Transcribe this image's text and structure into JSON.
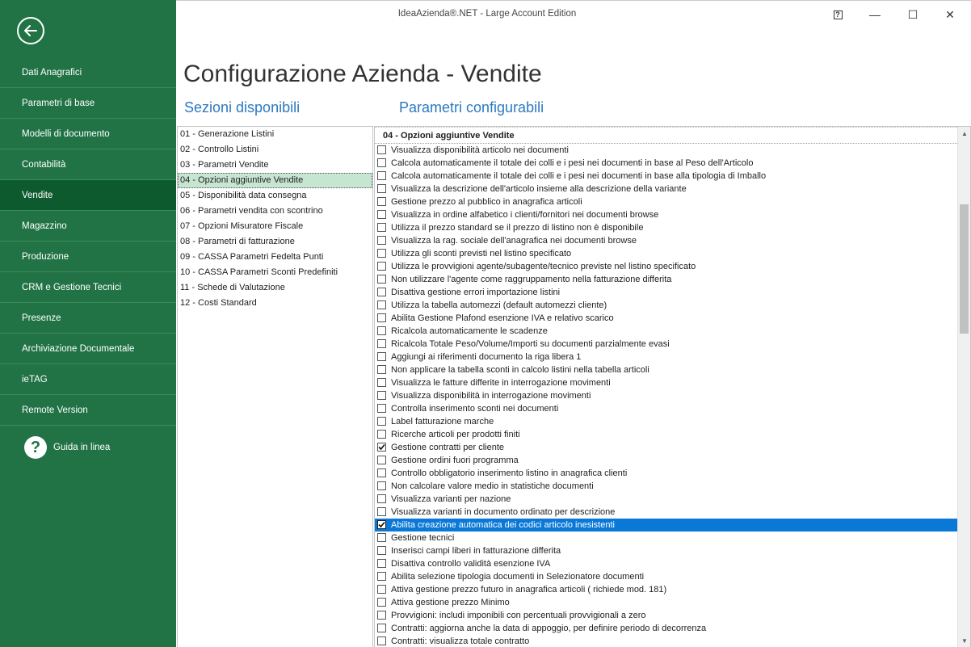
{
  "window": {
    "title": "IdeaAzienda®.NET - Large Account Edition",
    "help_glyph": "?",
    "minimize_glyph": "—",
    "maximize_glyph": "☐",
    "close_glyph": "✕"
  },
  "sidebar": {
    "items": [
      {
        "label": "Dati Anagrafici"
      },
      {
        "label": "Parametri di base"
      },
      {
        "label": "Modelli di documento"
      },
      {
        "label": "Contabilità"
      },
      {
        "label": "Vendite"
      },
      {
        "label": "Magazzino"
      },
      {
        "label": "Produzione"
      },
      {
        "label": "CRM e Gestione Tecnici"
      },
      {
        "label": "Presenze"
      },
      {
        "label": "Archiviazione Documentale"
      },
      {
        "label": "ieTAG"
      },
      {
        "label": "Remote Version"
      }
    ],
    "selected": "Vendite",
    "help_label": "Guida in linea",
    "help_glyph": "?"
  },
  "page": {
    "title": "Configurazione Azienda - Vendite",
    "sections_label": "Sezioni disponibili",
    "params_label": "Parametri configurabili"
  },
  "sections": [
    "01 - Generazione Listini",
    "02 - Controllo Listini",
    "03 - Parametri Vendite",
    "04 - Opzioni aggiuntive Vendite",
    "05 - Disponibilità data consegna",
    "06 - Parametri vendita con scontrino",
    "07 - Opzioni Misuratore Fiscale",
    "08 - Parametri di fatturazione",
    "09 - CASSA Parametri Fedelta Punti",
    "10 - CASSA Parametri Sconti Predefiniti",
    "11 - Schede di Valutazione",
    "12 - Costi Standard"
  ],
  "selected_section": "04 - Opzioni aggiuntive Vendite",
  "params": {
    "header": "04 - Opzioni aggiuntive Vendite",
    "rows": [
      {
        "label": "Visualizza disponibilità articolo nei documenti",
        "checked": false
      },
      {
        "label": "Calcola automaticamente il totale dei colli e i pesi nei documenti in base al Peso dell'Articolo",
        "checked": false
      },
      {
        "label": "Calcola automaticamente il totale dei colli e i pesi nei documenti in base alla tipologia di Imballo",
        "checked": false
      },
      {
        "label": "Visualizza la descrizione dell'articolo insieme alla descrizione della variante",
        "checked": false
      },
      {
        "label": "Gestione prezzo al pubblico in anagrafica articoli",
        "checked": false
      },
      {
        "label": "Visualizza in ordine alfabetico i clienti/fornitori nei documenti browse",
        "checked": false
      },
      {
        "label": "Utilizza il prezzo standard se il prezzo di listino non è disponibile",
        "checked": false
      },
      {
        "label": "Visualizza la rag. sociale dell'anagrafica nei documenti browse",
        "checked": false
      },
      {
        "label": "Utilizza gli sconti previsti nel listino specificato",
        "checked": false
      },
      {
        "label": "Utilizza le provvigioni agente/subagente/tecnico previste nel listino specificato",
        "checked": false
      },
      {
        "label": "Non utilizzare l'agente come raggruppamento nella fatturazione differita",
        "checked": false
      },
      {
        "label": "Disattiva gestione errori importazione listini",
        "checked": false
      },
      {
        "label": "Utilizza la tabella automezzi (default automezzi cliente)",
        "checked": false
      },
      {
        "label": "Abilita Gestione Plafond esenzione IVA e relativo scarico",
        "checked": false
      },
      {
        "label": "Ricalcola automaticamente le scadenze",
        "checked": false
      },
      {
        "label": "Ricalcola Totale Peso/Volume/Importi su documenti parzialmente evasi",
        "checked": false
      },
      {
        "label": "Aggiungi ai riferimenti documento la riga libera 1",
        "checked": false
      },
      {
        "label": "Non applicare la tabella sconti in calcolo listini nella tabella articoli",
        "checked": false
      },
      {
        "label": "Visualizza le fatture differite in interrogazione movimenti",
        "checked": false
      },
      {
        "label": "Visualizza disponibilità in interrogazione movimenti",
        "checked": false
      },
      {
        "label": "Controlla inserimento sconti nei documenti",
        "checked": false
      },
      {
        "label": "Label fatturazione marche",
        "checked": false
      },
      {
        "label": "Ricerche articoli per prodotti finiti",
        "checked": false
      },
      {
        "label": "Gestione contratti per cliente",
        "checked": true
      },
      {
        "label": "Gestione ordini fuori programma",
        "checked": false
      },
      {
        "label": "Controllo obbligatorio inserimento listino in anagrafica clienti",
        "checked": false
      },
      {
        "label": "Non calcolare valore medio in statistiche documenti",
        "checked": false
      },
      {
        "label": "Visualizza varianti per nazione",
        "checked": false
      },
      {
        "label": "Visualizza varianti in documento ordinato per descrizione",
        "checked": false
      },
      {
        "label": "Abilita creazione automatica dei codici articolo inesistenti",
        "checked": true,
        "selected": true
      },
      {
        "label": "Gestione tecnici",
        "checked": false
      },
      {
        "label": "Inserisci campi liberi in fatturazione differita",
        "checked": false
      },
      {
        "label": "Disattiva controllo validità esenzione IVA",
        "checked": false
      },
      {
        "label": "Abilita selezione tipologia documenti in Selezionatore documenti",
        "checked": false
      },
      {
        "label": "Attiva gestione prezzo futuro in anagrafica articoli ( richiede mod. 181)",
        "checked": false
      },
      {
        "label": "Attiva gestione prezzo Minimo",
        "checked": false
      },
      {
        "label": "Provvigioni: includi imponibili con percentuali provvigionali a zero",
        "checked": false
      },
      {
        "label": "Contratti: aggiorna anche la data di appoggio, per definire periodo di decorrenza",
        "checked": false
      },
      {
        "label": "Contratti: visualizza totale contratto",
        "checked": false
      }
    ]
  },
  "scrollbar": {
    "up_glyph": "▲",
    "down_glyph": "▼"
  },
  "colors": {
    "sidebar": "#217346",
    "sidebar_selected": "#0e5a2f",
    "accent_blue": "#2b79c2",
    "row_selected": "#0a78d7",
    "section_selected": "#c6e6d2"
  }
}
